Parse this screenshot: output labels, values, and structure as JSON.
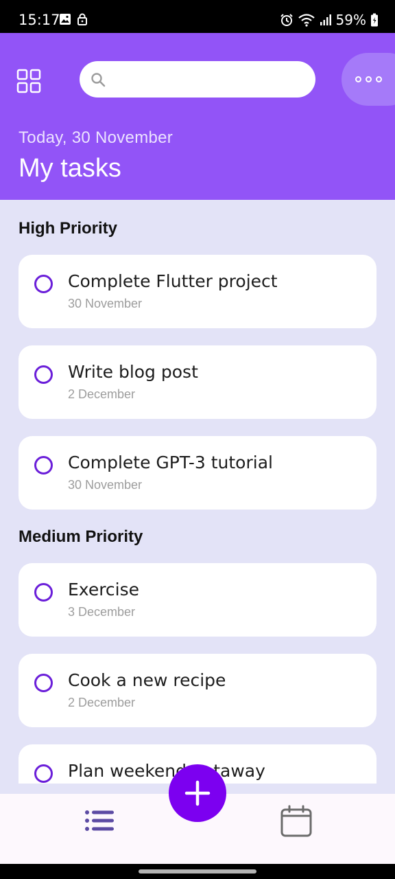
{
  "status_bar": {
    "time": "15:17",
    "battery": "59%",
    "icons": [
      "gallery-icon",
      "lock-icon",
      "alarm-icon",
      "wifi-icon",
      "signal-icon",
      "battery-icon"
    ]
  },
  "header": {
    "date": "Today, 30 November",
    "title": "My tasks",
    "search": {
      "value": "",
      "placeholder": ""
    },
    "menu_icon": "grid-icon",
    "more_icon": "more-dots-icon",
    "background_color": "#9254f7"
  },
  "sections": [
    {
      "title": "High Priority",
      "tasks": [
        {
          "title": "Complete Flutter project",
          "date": "30 November"
        },
        {
          "title": "Write blog post",
          "date": "2 December"
        },
        {
          "title": "Complete GPT-3 tutorial",
          "date": "30 November"
        }
      ]
    },
    {
      "title": "Medium Priority",
      "tasks": [
        {
          "title": "Exercise",
          "date": "3 December"
        },
        {
          "title": "Cook a new recipe",
          "date": "2 December"
        },
        {
          "title": "Plan weekend getaway",
          "date": ""
        }
      ]
    }
  ],
  "bottom_nav": {
    "items": [
      "list-icon",
      "calendar-icon"
    ],
    "fab_icon": "plus-icon",
    "accent_color": "#7c00f0"
  }
}
